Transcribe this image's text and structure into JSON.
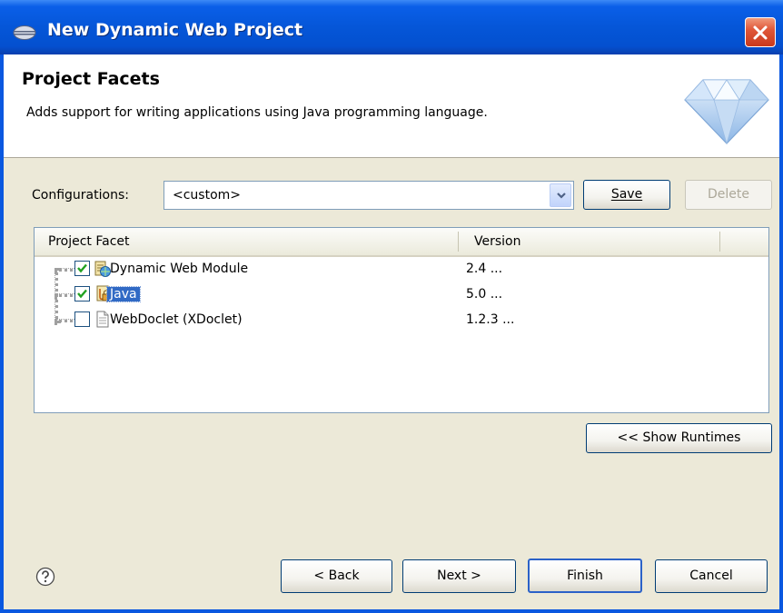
{
  "window": {
    "title": "New Dynamic Web Project"
  },
  "header": {
    "title": "Project Facets",
    "description": "Adds support for writing applications using Java programming language."
  },
  "configurations": {
    "label": "Configurations:",
    "value": "<custom>",
    "save_label": "Save",
    "delete_label": "Delete"
  },
  "facets_table": {
    "columns": [
      "Project Facet",
      "Version"
    ],
    "rows": [
      {
        "name": "Dynamic Web Module",
        "version": "2.4 ...",
        "checked": true,
        "icon": "web-module-icon"
      },
      {
        "name": "Java",
        "version": "5.0 ...",
        "checked": true,
        "icon": "java-icon",
        "selected": true
      },
      {
        "name": "WebDoclet (XDoclet)",
        "version": "1.2.3 ...",
        "checked": false,
        "icon": "document-icon"
      }
    ]
  },
  "show_runtimes_label": "<< Show Runtimes",
  "footer": {
    "back_label": "< Back",
    "next_label": "Next >",
    "finish_label": "Finish",
    "cancel_label": "Cancel"
  },
  "colors": {
    "titlebar": "#0556d8",
    "selection": "#316ac5",
    "dialog_bg": "#ece9d8"
  }
}
